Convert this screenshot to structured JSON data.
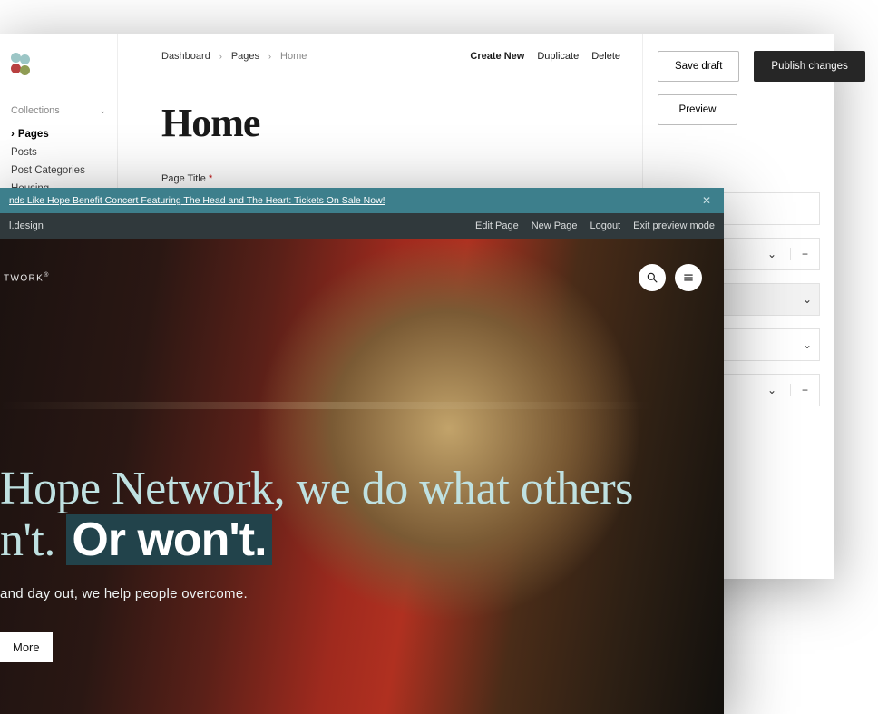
{
  "cms": {
    "sidebar": {
      "collections_label": "Collections",
      "items": [
        {
          "label": "Pages",
          "active": true
        },
        {
          "label": "Posts"
        },
        {
          "label": "Post Categories"
        },
        {
          "label": "Housing"
        }
      ]
    },
    "breadcrumbs": {
      "root": "Dashboard",
      "section": "Pages",
      "current": "Home"
    },
    "actions": {
      "create": "Create New",
      "duplicate": "Duplicate",
      "delete": "Delete"
    },
    "title": "Home",
    "field_page_title_label": "Page Title",
    "right": {
      "save_draft": "Save draft",
      "publish": "Publish changes",
      "preview": "Preview"
    }
  },
  "preview": {
    "announcement": "nds Like Hope Benefit Concert Featuring The Head and The Heart: Tickets On Sale Now!",
    "admin_left": "l.design",
    "admin_links": {
      "edit": "Edit Page",
      "new": "New Page",
      "logout": "Logout",
      "exit": "Exit preview mode"
    },
    "brand": "TWORK",
    "hero_line1": "Hope Network, we do what others",
    "hero_line2a": "n't.",
    "hero_line2b": "Or won't.",
    "hero_sub": "and day out, we help people overcome.",
    "hero_cta": "More"
  }
}
